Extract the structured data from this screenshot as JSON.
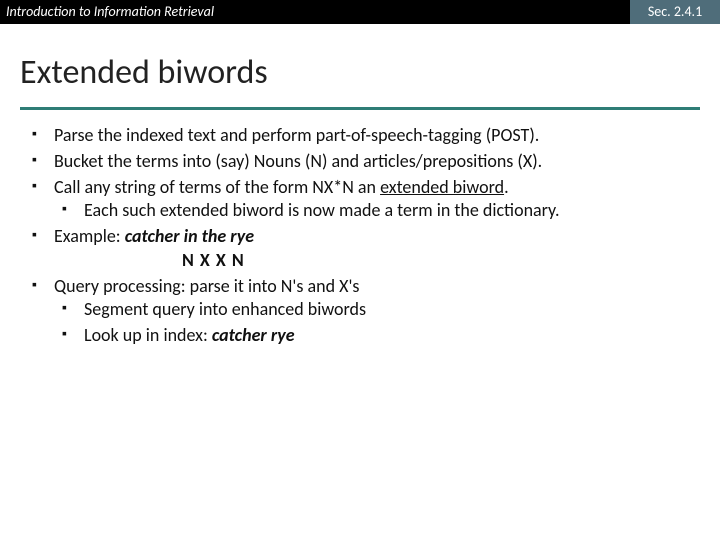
{
  "header": {
    "course": "Introduction to Information Retrieval",
    "section": "Sec. 2.4.1"
  },
  "title": "Extended biwords",
  "bullets": {
    "b1": "Parse the indexed text and perform part-of-speech-tagging (POST).",
    "b2": "Bucket the terms into (say) Nouns (N) and articles/prepositions (X).",
    "b3a": "Call any string of terms of the form NX*N an ",
    "b3u": "extended biword",
    "b3b": ".",
    "b3_1": "Each such extended biword is now made a term in the dictionary.",
    "b4a": "Example:  ",
    "b4b": "catcher in the rye",
    "b4row": "N      X  X   N",
    "b5": "Query processing: parse it into N's and X's",
    "b5_1": "Segment query into enhanced biwords",
    "b5_2a": "Look up in index: ",
    "b5_2b": "catcher rye"
  }
}
